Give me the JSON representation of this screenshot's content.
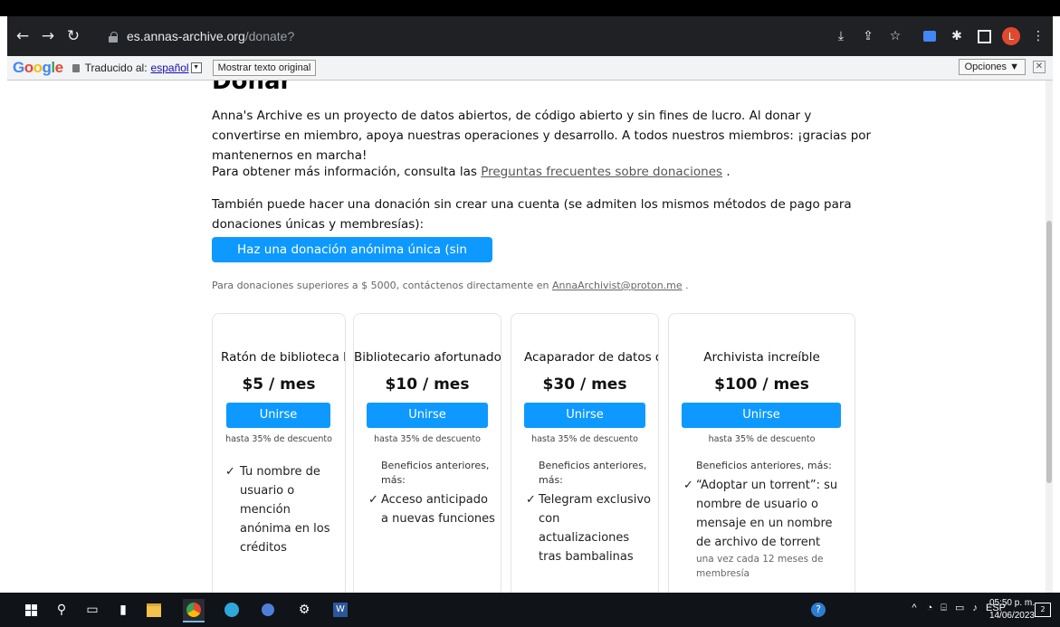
{
  "browser": {
    "url_host": "es.annas-archive.org",
    "url_path": "/donate?"
  },
  "translate_bar": {
    "logo": "Google",
    "translated_to_label": "Traducido al:",
    "language": "español",
    "show_original": "Mostrar texto original",
    "options": "Opciones ▼",
    "close": "✕"
  },
  "page": {
    "heading": "Donar",
    "intro": "Anna's Archive es un proyecto de datos abiertos, de código abierto y sin fines de lucro. Al donar y convertirse en miembro, apoya nuestras operaciones y desarrollo. A todos nuestros miembros: ¡gracias por mantenernos en marcha!",
    "more_info_prefix": "Para obtener más información, consulta las",
    "more_info_link": "Preguntas frecuentes sobre donaciones",
    "more_info_suffix": ".",
    "anon_text": "También puede hacer una donación sin crear una cuenta (se admiten los mismos métodos de pago para donaciones únicas y membresías):",
    "anon_button": "Haz una donación anónima única (sin ventajas)",
    "large_prefix": "Para donaciones superiores a $ 5000, contáctenos directamente en",
    "large_email": "AnnaArchivist@proton.me",
    "large_suffix": "."
  },
  "tiers": [
    {
      "title": "Ratón de biblioteca brillante",
      "price": "$5 / mes",
      "button": "Unirse",
      "discount": "hasta 35% de descuento",
      "benefit": "Tu nombre de usuario o mención anónima en los créditos"
    },
    {
      "title": "Bibliotecario afortunado",
      "price": "$10 / mes",
      "button": "Unirse",
      "discount": "hasta 35% de descuento",
      "pre": "Beneficios anteriores, más:",
      "benefit": "Acceso anticipado a nuevas funciones"
    },
    {
      "title": "Acaparador de datos deslumbrante",
      "price": "$30 / mes",
      "button": "Unirse",
      "discount": "hasta 35% de descuento",
      "pre": "Beneficios anteriores, más:",
      "benefit": "Telegram exclusivo con actualizaciones tras bambalinas"
    },
    {
      "title": "Archivista increíble",
      "price": "$100 / mes",
      "button": "Unirse",
      "discount": "hasta 35% de descuento",
      "pre": "Beneficios anteriores, más:",
      "benefit": "“Adoptar un torrent”: su nombre de usuario o mensaje en un nombre de archivo de torrent",
      "note": "una vez cada 12 meses de membresía"
    }
  ],
  "taskbar": {
    "lang": "ESP",
    "time": "05:50 p. m.",
    "date": "14/06/2023",
    "notifications": "2"
  },
  "colors": {
    "accent_blue": "#0d99ff",
    "chrome_dark": "#202124",
    "taskbar": "#101318"
  }
}
